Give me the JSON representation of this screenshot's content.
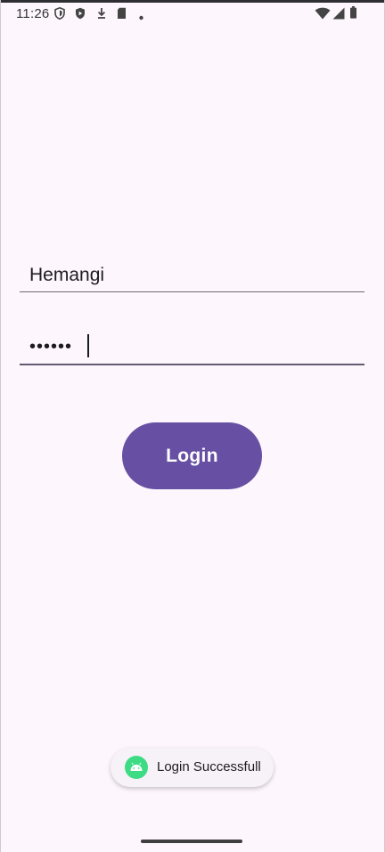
{
  "status_bar": {
    "time": "11:26",
    "left_icons": [
      "shield-icon",
      "play-protect-icon",
      "download-icon",
      "sim-card-icon",
      "dot-icon"
    ],
    "right_icons": [
      "wifi-icon",
      "cell-signal-icon",
      "battery-icon"
    ]
  },
  "login_form": {
    "username_value": "Hemangi",
    "password_masked": "••••••",
    "login_label": "Login"
  },
  "toast": {
    "message": "Login Successfull",
    "icon": "android-icon"
  },
  "colors": {
    "background": "#fdf7fd",
    "primary": "#6750a4",
    "toast_bg": "#f7f2f7",
    "android_green": "#3ddc84"
  }
}
